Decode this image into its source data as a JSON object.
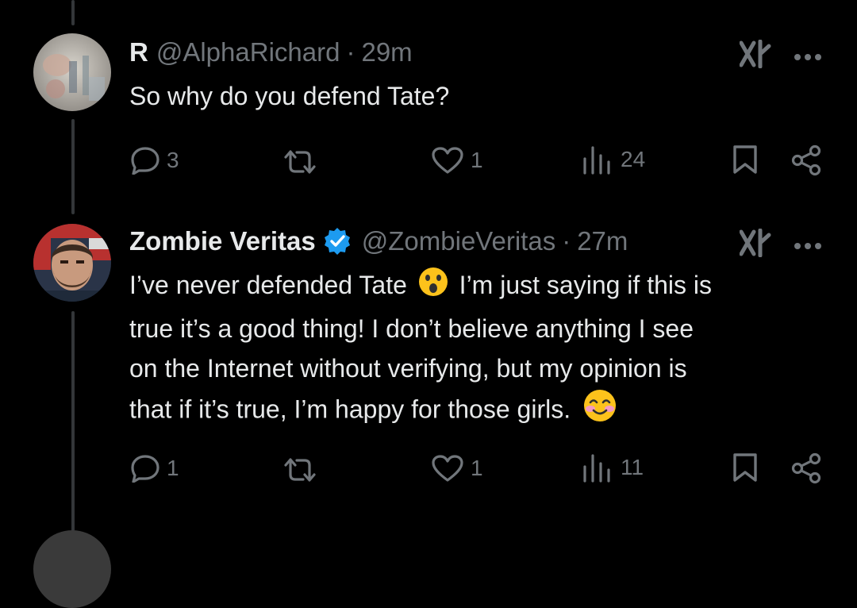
{
  "tweets": [
    {
      "display_name": "R",
      "handle": "@AlphaRichard",
      "separator": "·",
      "time": "29m",
      "body": "So why do you defend Tate?",
      "actions": {
        "replies": "3",
        "reposts": "",
        "likes": "1",
        "views": "24"
      }
    },
    {
      "display_name": "Zombie Veritas",
      "verified": true,
      "handle": "@ZombieVeritas",
      "separator": "·",
      "time": "27m",
      "body_parts": [
        "I’ve never defended Tate",
        "I’m just saying if this is",
        "true it’s a good thing! I don’t believe anything I see",
        "on the Internet without verifying, but my opinion is",
        "that if it’s true, I’m happy for those girls."
      ],
      "actions": {
        "replies": "1",
        "reposts": "",
        "likes": "1",
        "views": "11"
      }
    }
  ],
  "icons": [
    "reply-icon",
    "repost-icon",
    "like-icon",
    "views-icon",
    "bookmark-icon",
    "share-icon",
    "grok-icon",
    "more-icon",
    "verified-badge-icon"
  ],
  "colors": {
    "background": "#000000",
    "text": "#e7e9ea",
    "muted": "#71767b",
    "verified": "#1d9bf0",
    "thread_line": "#333639"
  }
}
